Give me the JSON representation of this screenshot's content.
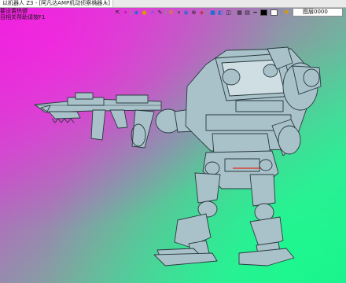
{
  "tab": {
    "title": "以机器人 Z3 - [阿凡达AMP机动侦察机器人]",
    "close": "✕",
    "add": "+"
  },
  "command_lines": [
    "要设置热键",
    "目相关帮助请按F1"
  ],
  "layer": {
    "name": "图层0000"
  },
  "colors": {
    "bg_top_left": "#e61fd9",
    "bg_bottom_right": "#22e88f",
    "model_fill": "#a9c2c9",
    "model_line": "#29393f",
    "accent_red": "#d8453b"
  },
  "toolbar_icons": [
    "pointer-icon",
    "shape-icon",
    "display-mode-icon",
    "color-icon",
    "arrow-icon",
    "edit-icon",
    "gear-icon",
    "view-icon",
    "axis-icon",
    "style-icon",
    "cube-icon",
    "render-icon",
    "bulb-icon",
    "black-swatch",
    "white-swatch"
  ]
}
